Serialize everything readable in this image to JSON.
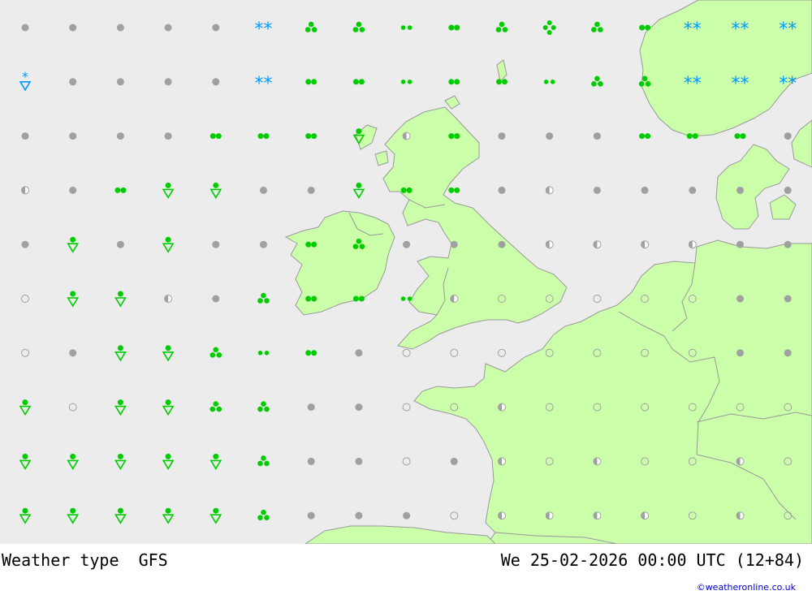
{
  "title": "Weather type",
  "model": "GFS",
  "valid_time": "We 25-02-2026 00:00 UTC (12+84)",
  "credit": "©weatheronline.co.uk",
  "colors": {
    "sea": "#ececec",
    "land": "#ccffaa",
    "border": "#999999",
    "precip_green": "#00cc00",
    "snow_blue": "#0099ff",
    "dry_gray": "#a0a0a0"
  },
  "legend_symbols": {
    "gray_dot": "overcast",
    "half_dot": "partly cloudy",
    "open_circle": "clear",
    "two_dots": "light rain",
    "diamond_dots": "drizzle",
    "three_dots": "rain",
    "four_dots": "heavy rain",
    "shower": "rain shower",
    "snow_shower": "snow shower",
    "stars": "snow"
  },
  "grid": [
    [
      "gray_dot",
      "gray_dot",
      "gray_dot",
      "gray_dot",
      "gray_dot",
      "stars",
      "three_dots",
      "three_dots",
      "diamond_dots",
      "two_dots",
      "three_dots",
      "four_dots",
      "three_dots",
      "two_dots",
      "stars",
      "stars",
      "stars"
    ],
    [
      "snow_shower",
      "gray_dot",
      "gray_dot",
      "gray_dot",
      "gray_dot",
      "stars",
      "two_dots",
      "two_dots",
      "diamond_dots",
      "two_dots",
      "two_dots",
      "diamond_dots",
      "three_dots",
      "three_dots",
      "stars",
      "stars",
      "stars"
    ],
    [
      "gray_dot",
      "gray_dot",
      "gray_dot",
      "gray_dot",
      "two_dots",
      "two_dots",
      "two_dots",
      "shower",
      "half_dot",
      "two_dots",
      "gray_dot",
      "gray_dot",
      "gray_dot",
      "two_dots",
      "two_dots",
      "two_dots",
      "gray_dot"
    ],
    [
      "half_dot",
      "gray_dot",
      "two_dots",
      "shower",
      "shower",
      "gray_dot",
      "gray_dot",
      "shower",
      "two_dots",
      "two_dots",
      "gray_dot",
      "half_dot",
      "gray_dot",
      "gray_dot",
      "gray_dot",
      "gray_dot",
      "gray_dot"
    ],
    [
      "gray_dot",
      "shower",
      "gray_dot",
      "shower",
      "gray_dot",
      "gray_dot",
      "two_dots",
      "three_dots",
      "gray_dot",
      "gray_dot",
      "gray_dot",
      "half_dot",
      "half_dot",
      "half_dot",
      "half_dot",
      "gray_dot",
      "gray_dot"
    ],
    [
      "open_circle",
      "shower",
      "shower",
      "half_dot",
      "gray_dot",
      "three_dots",
      "two_dots",
      "two_dots",
      "diamond_dots",
      "half_dot",
      "open_circle",
      "open_circle",
      "open_circle",
      "open_circle",
      "open_circle",
      "gray_dot",
      "gray_dot"
    ],
    [
      "open_circle",
      "gray_dot",
      "shower",
      "shower",
      "three_dots",
      "diamond_dots",
      "two_dots",
      "gray_dot",
      "open_circle",
      "open_circle",
      "open_circle",
      "open_circle",
      "open_circle",
      "open_circle",
      "open_circle",
      "gray_dot",
      "gray_dot"
    ],
    [
      "shower",
      "open_circle",
      "shower",
      "shower",
      "three_dots",
      "three_dots",
      "gray_dot",
      "gray_dot",
      "open_circle",
      "open_circle",
      "half_dot",
      "open_circle",
      "open_circle",
      "open_circle",
      "open_circle",
      "open_circle",
      "open_circle"
    ],
    [
      "shower",
      "shower",
      "shower",
      "shower",
      "shower",
      "three_dots",
      "gray_dot",
      "gray_dot",
      "open_circle",
      "gray_dot",
      "half_dot",
      "open_circle",
      "half_dot",
      "open_circle",
      "open_circle",
      "half_dot",
      "open_circle"
    ],
    [
      "shower",
      "shower",
      "shower",
      "shower",
      "shower",
      "three_dots",
      "gray_dot",
      "gray_dot",
      "gray_dot",
      "open_circle",
      "half_dot",
      "half_dot",
      "half_dot",
      "half_dot",
      "open_circle",
      "half_dot",
      "open_circle"
    ]
  ]
}
